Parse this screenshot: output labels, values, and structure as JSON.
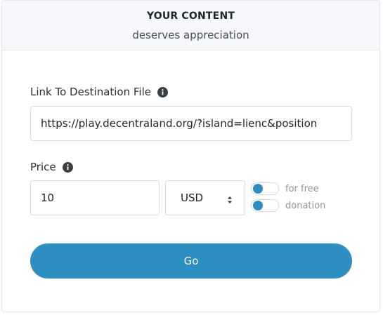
{
  "header": {
    "title": "YOUR CONTENT",
    "subtitle": "deserves appreciation"
  },
  "link_field": {
    "label": "Link To Destination File",
    "value": "https://play.decentraland.org/?island=lienc&position",
    "info_icon": "info-icon"
  },
  "price_field": {
    "label": "Price",
    "value": "10",
    "info_icon": "info-icon"
  },
  "currency": {
    "selected": "USD"
  },
  "toggles": [
    {
      "label": "for free",
      "on": false
    },
    {
      "label": "donation",
      "on": false
    }
  ],
  "go_button": {
    "label": "Go"
  },
  "colors": {
    "accent": "#2d8ec1",
    "header_bg": "#f6f7fb",
    "muted_text": "#8f959d"
  }
}
